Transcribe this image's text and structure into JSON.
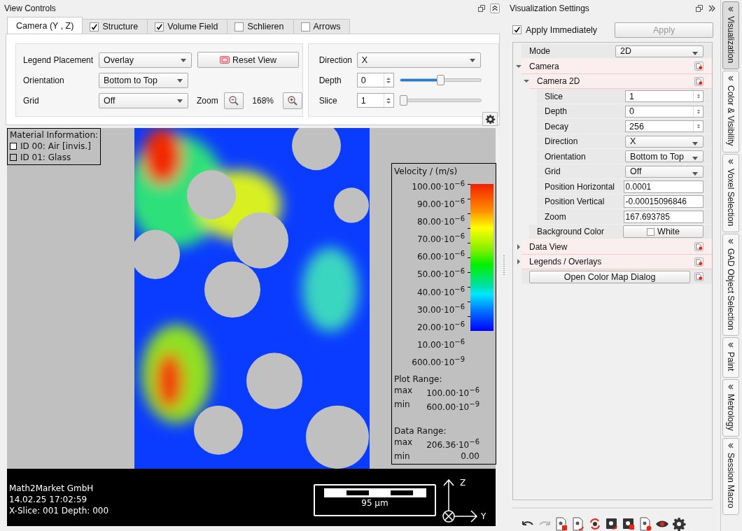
{
  "view_controls": {
    "title": "View Controls",
    "tabs": [
      {
        "label": "Camera (Y , Z)",
        "kind": "plain",
        "selected": true
      },
      {
        "label": "Structure",
        "kind": "check",
        "checked": true,
        "selected": false
      },
      {
        "label": "Volume Field",
        "kind": "check",
        "checked": true,
        "selected": false
      },
      {
        "label": "Schlieren",
        "kind": "check",
        "checked": false,
        "selected": false
      },
      {
        "label": "Arrows",
        "kind": "check",
        "checked": false,
        "selected": false
      }
    ],
    "camera": {
      "legend_placement": {
        "label": "Legend Placement",
        "value": "Overlay"
      },
      "reset_button": "Reset View",
      "orientation": {
        "label": "Orientation",
        "value": "Bottom to Top"
      },
      "grid": {
        "label": "Grid",
        "value": "Off"
      },
      "zoom": {
        "label": "Zoom",
        "value": "168%"
      },
      "direction": {
        "label": "Direction",
        "value": "X"
      },
      "depth": {
        "label": "Depth",
        "value": "0",
        "level": 0.5
      },
      "slice": {
        "label": "Slice",
        "value": "1",
        "level": 0
      }
    }
  },
  "viewer": {
    "material_info": {
      "title": "Material Information:",
      "items": [
        {
          "label": "ID 00: Air [invis.]",
          "color": "#ffffff"
        },
        {
          "label": "ID 01: Glass",
          "color": "#c0c0c0"
        }
      ]
    },
    "legend": {
      "title": "Velocity / (m/s)",
      "ticks": [
        "100.00·10$^{−6}$",
        "90.00·10$^{−6}$",
        "80.00·10$^{−6}$",
        "70.00·10$^{−6}$",
        "60.00·10$^{−6}$",
        "50.00·10$^{−6}$",
        "40.00·10$^{−6}$",
        "30.00·10$^{−6}$",
        "20.00·10$^{−6}$",
        "10.00·10$^{−6}$",
        "600.00·10$^{−9}$"
      ],
      "ranges": [
        {
          "title": "Plot Range:",
          "rows": [
            {
              "label": "max",
              "value": "100.00·10$^{−6}$"
            },
            {
              "label": "min",
              "value": "600.00·10$^{−9}$"
            }
          ]
        },
        {
          "title": "Data Range:",
          "rows": [
            {
              "label": "max",
              "value": "206.36·10$^{−6}$"
            },
            {
              "label": "min",
              "value": "0.00"
            }
          ]
        }
      ]
    },
    "info_lines": [
      "Math2Market GmbH",
      "14.02.25 17:02:59",
      "X-Slice: 001 Depth: 000"
    ],
    "scale_bar": "95 µm",
    "axes": {
      "up": "Z",
      "right": "Y"
    }
  },
  "settings": {
    "title": "Visualization Settings",
    "apply_immediately": {
      "label": "Apply Immediately",
      "checked": true
    },
    "apply_button": {
      "label": "Apply",
      "disabled": true
    },
    "tree": [
      {
        "label": "Mode",
        "kind": "dropdown",
        "value": "2D"
      },
      {
        "label": "Camera",
        "kind": "group",
        "expanded": true,
        "children": [
          {
            "label": "Camera 2D",
            "kind": "group",
            "expanded": true,
            "children": [
              {
                "label": "Slice",
                "kind": "spin",
                "value": "1"
              },
              {
                "label": "Depth",
                "kind": "spin",
                "value": "0"
              },
              {
                "label": "Decay",
                "kind": "spin",
                "value": "256"
              },
              {
                "label": "Direction",
                "kind": "dropdown",
                "value": "X"
              },
              {
                "label": "Orientation",
                "kind": "dropdown",
                "value": "Bottom to Top"
              },
              {
                "label": "Grid",
                "kind": "dropdown",
                "value": "Off"
              },
              {
                "label": "Position Horizontal",
                "kind": "text",
                "value": "0.0001"
              },
              {
                "label": "Position Vertical",
                "kind": "text",
                "value": "-0.00015096846"
              },
              {
                "label": "Zoom",
                "kind": "text",
                "value": "167.693785"
              }
            ]
          },
          {
            "label": "Background Color",
            "kind": "color",
            "value": "White",
            "color": "#ffffff"
          }
        ]
      },
      {
        "label": "Data View",
        "kind": "group",
        "expanded": false
      },
      {
        "label": "Legends / Overlays",
        "kind": "group",
        "expanded": false
      },
      {
        "label": "Open Color Map Dialog",
        "kind": "button"
      }
    ],
    "toolbar": [
      {
        "kind": "undo",
        "disabled": false
      },
      {
        "kind": "redo",
        "disabled": true
      },
      {
        "kind": "doc-save",
        "disabled": false
      },
      {
        "kind": "doc-load",
        "disabled": false
      },
      {
        "kind": "reload",
        "disabled": false
      },
      {
        "kind": "dark-load",
        "disabled": false
      },
      {
        "kind": "dark-save",
        "disabled": false
      },
      {
        "kind": "doc-record",
        "disabled": false
      },
      {
        "kind": "eye",
        "disabled": false
      },
      {
        "kind": "gear",
        "disabled": false
      }
    ]
  },
  "side_tabs": [
    {
      "label": "Visualization",
      "selected": true
    },
    {
      "label": "Color & Visibility",
      "selected": false
    },
    {
      "label": "Voxel Selection",
      "selected": false
    },
    {
      "label": "GAD Object Selection",
      "selected": false
    },
    {
      "label": "Paint",
      "selected": false
    },
    {
      "label": "Metrology",
      "selected": false
    },
    {
      "label": "Session Macro",
      "selected": false
    }
  ]
}
